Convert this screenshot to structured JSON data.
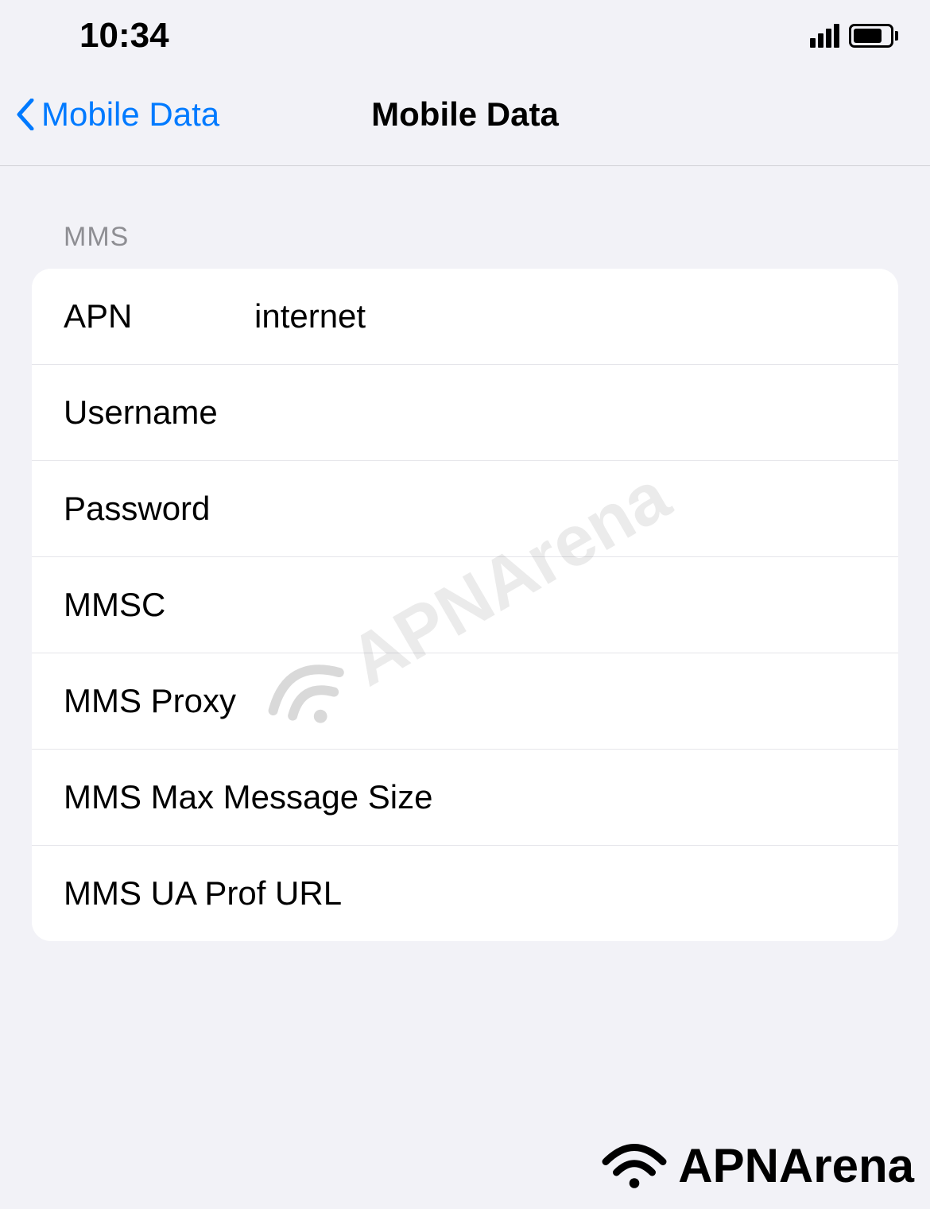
{
  "statusBar": {
    "time": "10:34"
  },
  "nav": {
    "backLabel": "Mobile Data",
    "title": "Mobile Data"
  },
  "sectionHeader": "MMS",
  "fields": {
    "apn": {
      "label": "APN",
      "value": "internet"
    },
    "username": {
      "label": "Username",
      "value": ""
    },
    "password": {
      "label": "Password",
      "value": ""
    },
    "mmsc": {
      "label": "MMSC",
      "value": ""
    },
    "mmsProxy": {
      "label": "MMS Proxy",
      "value": ""
    },
    "mmsMax": {
      "label": "MMS Max Message Size",
      "value": ""
    },
    "mmsUa": {
      "label": "MMS UA Prof URL",
      "value": ""
    }
  },
  "watermark": "APNArena",
  "brand": "APNArena"
}
